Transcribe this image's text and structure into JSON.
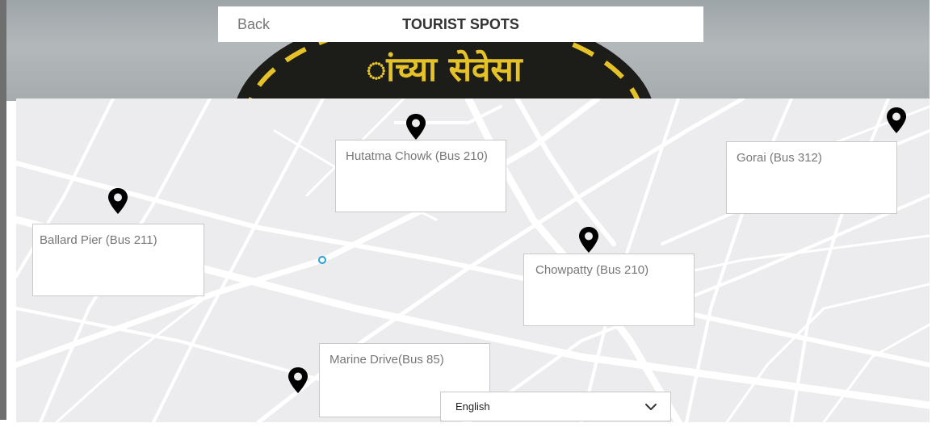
{
  "header": {
    "back_label": "Back",
    "title": "TOURIST SPOTS"
  },
  "background": {
    "emblem_text": "ांच्या सेवेसा"
  },
  "spots": [
    {
      "name": "Hutatma Chowk (Bus 210)",
      "icon": "map-pin-icon"
    },
    {
      "name": "Gorai (Bus 312)",
      "icon": "map-pin-icon"
    },
    {
      "name": "Ballard Pier (Bus 211)",
      "icon": "map-pin-icon"
    },
    {
      "name": "Chowpatty (Bus 210)",
      "icon": "map-pin-icon"
    },
    {
      "name": "Marine Drive(Bus 85)",
      "icon": "map-pin-icon"
    }
  ],
  "language": {
    "selected": "English"
  },
  "colors": {
    "map_bg": "#ececef",
    "roads": "#ffffff",
    "pin": "#000000",
    "location_dot": "#2aa0d8",
    "emblem": "#e6c229"
  }
}
